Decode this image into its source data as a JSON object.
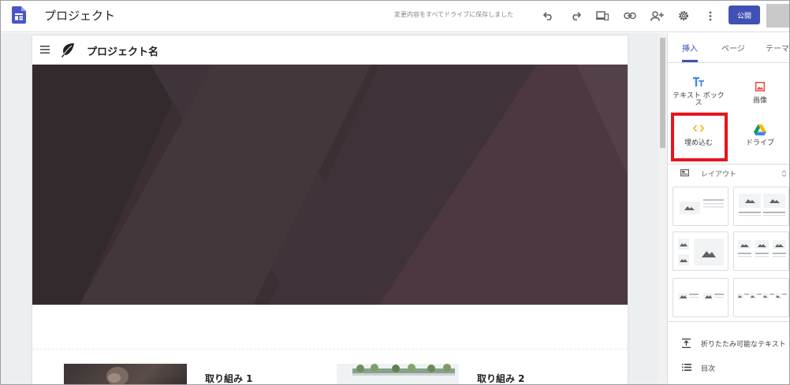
{
  "topbar": {
    "title": "プロジェクト",
    "save_status": "変更内容をすべてドライブに保存しました",
    "publish_label": "公開"
  },
  "page": {
    "site_name": "プロジェクト名",
    "cards": [
      {
        "title": "取り組み 1"
      },
      {
        "title": "取り組み 2"
      }
    ]
  },
  "panel": {
    "tabs": [
      {
        "label": "挿入",
        "active": true
      },
      {
        "label": "ページ",
        "active": false
      },
      {
        "label": "テーマ",
        "active": false
      }
    ],
    "insert_items": [
      {
        "label_line1": "テキスト ボック",
        "label_line2": "ス",
        "icon": "text-box-icon"
      },
      {
        "label_line1": "画像",
        "label_line2": "",
        "icon": "image-icon"
      },
      {
        "label_line1": "埋め込む",
        "label_line2": "",
        "icon": "embed-icon"
      },
      {
        "label_line1": "ドライブ",
        "label_line2": "",
        "icon": "drive-icon"
      }
    ],
    "layout_label": "レイアウト",
    "bottom_items": [
      {
        "label": "折りたたみ可能なテキスト",
        "icon": "collapsible-text-icon"
      },
      {
        "label": "目次",
        "icon": "table-of-contents-icon"
      }
    ]
  },
  "colors": {
    "accent": "#3f51b5",
    "highlight": "#e8141c",
    "hero": "#3b2f34"
  }
}
